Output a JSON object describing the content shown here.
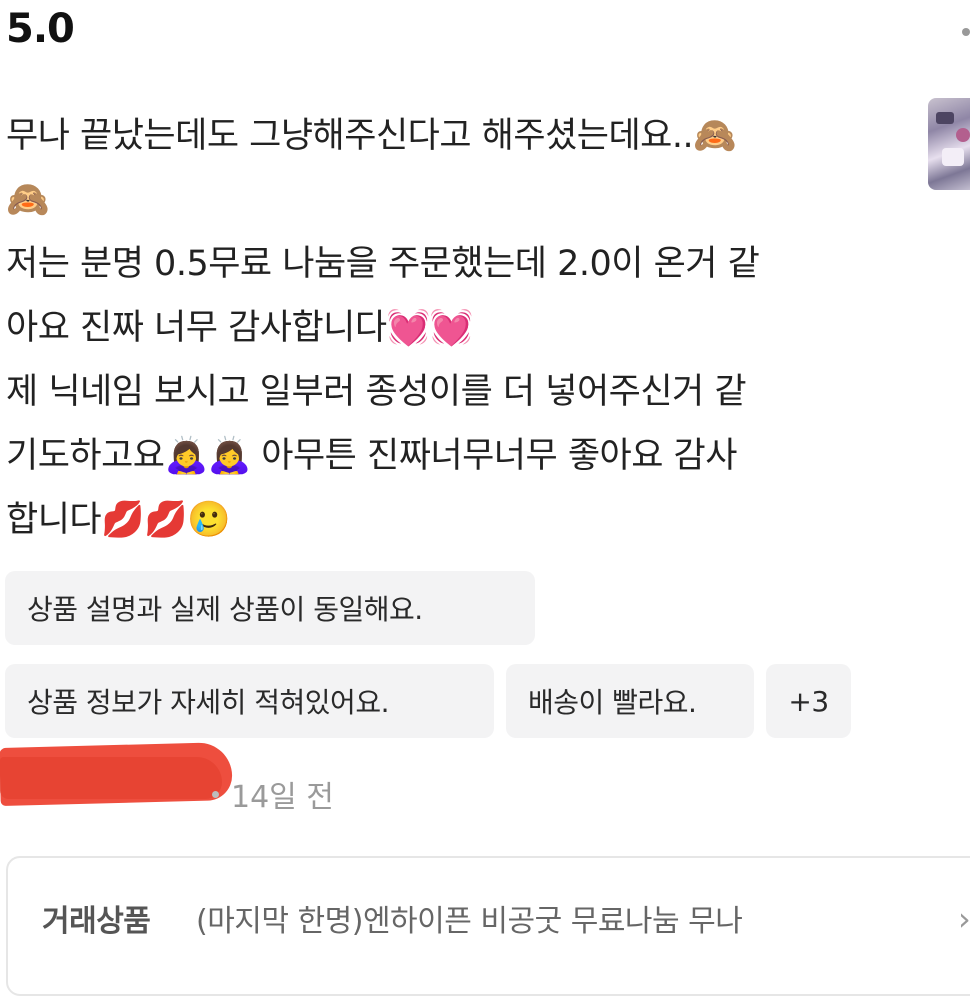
{
  "rating": "5.0",
  "review": {
    "lines": [
      "무나 끝났는데도 그냥해주신다고 해주셨는데요..🙈",
      "🙈",
      "저는 분명 0.5무료 나눔을 주문했는데 2.0이 온거 같",
      "아요 진짜 너무 감사합니다💓💓",
      "제 닉네임 보시고 일부러 종성이를 더 넣어주신거 같",
      "기도하고요🙇‍♀️🙇‍♀️ 아무튼 진짜너무너무 좋아요 감사",
      "합니다💋💋🥲"
    ]
  },
  "tags": [
    "상품 설명과 실제 상품이 동일해요.",
    "상품 정보가 자세히 적혀있어요.",
    "배송이 빨라요.",
    "+3"
  ],
  "meta": {
    "time": "14일 전"
  },
  "product": {
    "label": "거래상품",
    "name": "(마지막 한명)엔하이픈 비공굿 무료나눔 무나",
    "chevron": "›"
  },
  "icons": {
    "more": "more-dots-icon",
    "chevron": "chevron-right-icon"
  }
}
